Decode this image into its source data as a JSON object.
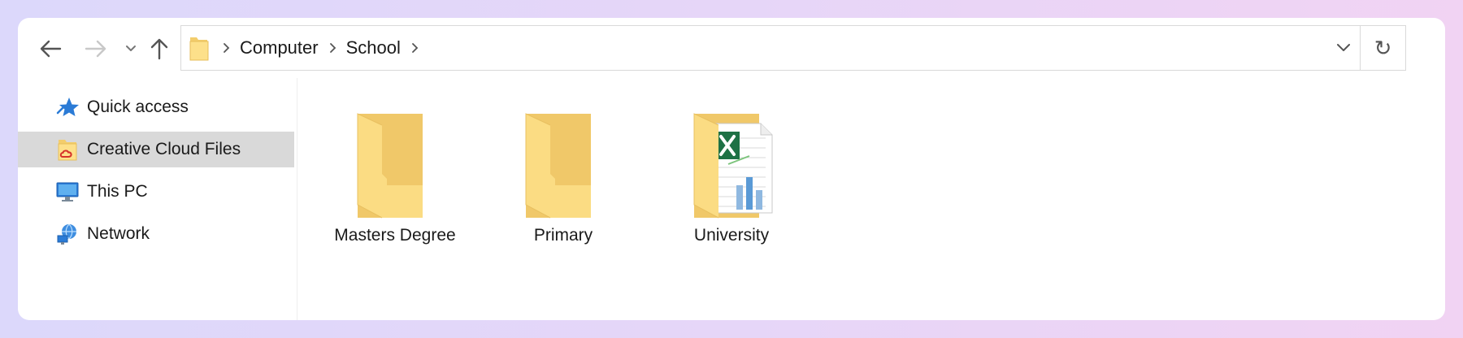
{
  "toolbar": {
    "back_icon": "arrow-left-icon",
    "forward_icon": "arrow-right-icon",
    "recent_icon": "chevron-down-icon",
    "up_icon": "arrow-up-icon",
    "refresh_glyph": "↻"
  },
  "address": {
    "crumbs": [
      "Computer",
      "School"
    ]
  },
  "sidebar": {
    "items": [
      {
        "label": "Quick access",
        "icon": "star-icon",
        "selected": false
      },
      {
        "label": "Creative Cloud Files",
        "icon": "creative-cloud-folder-icon",
        "selected": true
      },
      {
        "label": "This PC",
        "icon": "monitor-icon",
        "selected": false
      },
      {
        "label": "Network",
        "icon": "network-icon",
        "selected": false
      }
    ]
  },
  "files": [
    {
      "label": "Masters Degree",
      "icon": "folder-icon"
    },
    {
      "label": "Primary",
      "icon": "folder-icon"
    },
    {
      "label": "University",
      "icon": "folder-with-excel-icon"
    }
  ],
  "colors": {
    "folder_front": "#fbdc83",
    "folder_back": "#f0c869",
    "selection": "#d9d9d9",
    "excel_green": "#1e7145"
  }
}
